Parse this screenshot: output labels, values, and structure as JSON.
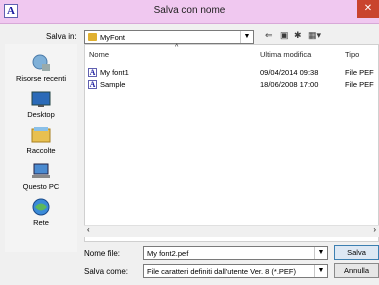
{
  "window": {
    "title": "Salva con nome",
    "close_glyph": "✕",
    "app_icon_letter": "A"
  },
  "toolbar": {
    "save_in_label": "Salva in:",
    "save_in_value": "MyFont",
    "icons": [
      "back-arrow-icon",
      "up-folder-icon",
      "new-folder-icon",
      "view-menu-icon"
    ]
  },
  "places": [
    {
      "label": "Risorse recenti",
      "icon": "recent-places-icon"
    },
    {
      "label": "Desktop",
      "icon": "desktop-icon"
    },
    {
      "label": "Raccolte",
      "icon": "libraries-icon"
    },
    {
      "label": "Questo PC",
      "icon": "this-pc-icon"
    },
    {
      "label": "Rete",
      "icon": "network-icon"
    }
  ],
  "columns": {
    "name": "Nome",
    "modified": "Ultima modifica",
    "type": "Tipo"
  },
  "files": [
    {
      "name": "My font1",
      "modified": "09/04/2014 09:38",
      "type": "File PEF"
    },
    {
      "name": "Sample",
      "modified": "18/06/2008 17:00",
      "type": "File PEF"
    }
  ],
  "footer": {
    "filename_label": "Nome file:",
    "filename_value": "My font2.pef",
    "filetype_label": "Salva come:",
    "filetype_value": "File caratteri definiti dall'utente Ver. 8 (*.PEF)",
    "save_button": "Salva",
    "cancel_button": "Annulla"
  }
}
